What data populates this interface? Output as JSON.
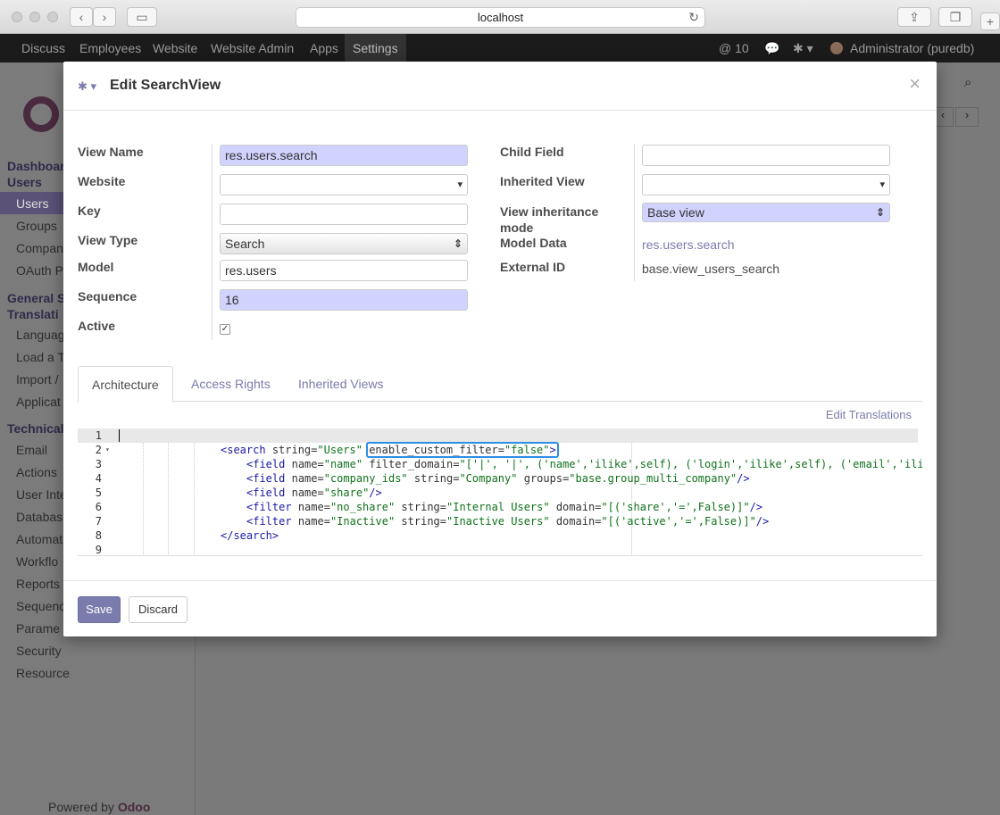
{
  "browser": {
    "url": "localhost"
  },
  "topnav": {
    "menus": [
      "Discuss",
      "Employees",
      "Website",
      "Website Admin",
      "Apps",
      "Settings"
    ],
    "active_menu": "Settings",
    "mentions": "@ 10",
    "user": "Administrator (puredb)"
  },
  "sidebar": {
    "items": [
      {
        "label": "Dashboar",
        "type": "section"
      },
      {
        "label": "Users",
        "type": "section-selected"
      },
      {
        "label": "Users",
        "type": "item"
      },
      {
        "label": "Groups",
        "type": "item"
      },
      {
        "label": "Compan",
        "type": "item"
      },
      {
        "label": "OAuth P",
        "type": "item"
      },
      {
        "label": "General S",
        "type": "section"
      },
      {
        "label": "Translati",
        "type": "section"
      },
      {
        "label": "Languag",
        "type": "item"
      },
      {
        "label": "Load a T",
        "type": "item"
      },
      {
        "label": "Import /",
        "type": "item"
      },
      {
        "label": "Applicat",
        "type": "item"
      },
      {
        "label": "Technical",
        "type": "section"
      },
      {
        "label": "Email",
        "type": "item"
      },
      {
        "label": "Actions",
        "type": "item"
      },
      {
        "label": "User Inte",
        "type": "item"
      },
      {
        "label": "Databas",
        "type": "item"
      },
      {
        "label": "Automat",
        "type": "item"
      },
      {
        "label": "Workflo",
        "type": "item"
      },
      {
        "label": "Reports",
        "type": "item"
      },
      {
        "label": "Sequenc",
        "type": "item"
      },
      {
        "label": "Parame",
        "type": "item"
      },
      {
        "label": "Security",
        "type": "item"
      },
      {
        "label": "Resource",
        "type": "item"
      }
    ],
    "powered_prefix": "Powered by",
    "powered_brand": "Odoo"
  },
  "modal": {
    "title": "Edit SearchView",
    "left_fields": [
      {
        "label": "View Name",
        "value": "res.users.search"
      },
      {
        "label": "Website",
        "value": ""
      },
      {
        "label": "Key",
        "value": ""
      },
      {
        "label": "View Type",
        "value": "Search"
      },
      {
        "label": "Model",
        "value": "res.users"
      },
      {
        "label": "Sequence",
        "value": "16"
      },
      {
        "label": "Active",
        "value": "✓"
      }
    ],
    "right_fields": [
      {
        "label": "Child Field",
        "value": ""
      },
      {
        "label": "Inherited View",
        "value": ""
      },
      {
        "label": "View inheritance",
        "label2": "mode",
        "value": "Base view"
      },
      {
        "label": "Model Data",
        "value": "res.users.search"
      },
      {
        "label": "External ID",
        "value": "base.view_users_search"
      }
    ],
    "tabs": [
      "Architecture",
      "Access Rights",
      "Inherited Views"
    ],
    "active_tab": "Architecture",
    "edit_translations": "Edit Translations",
    "code_lines": [
      {
        "n": "1",
        "html": ""
      },
      {
        "n": "2",
        "html": "<search string=\"Users\" enable_custom_filter=\"false\">"
      },
      {
        "n": "3",
        "html": "<field name=\"name\" filter_domain=\"['|', '|', ('name','ilike',self), ('login','ilike',self), ('email','ili"
      },
      {
        "n": "4",
        "html": "<field name=\"company_ids\" string=\"Company\" groups=\"base.group_multi_company\"/>"
      },
      {
        "n": "5",
        "html": "<field name=\"share\"/>"
      },
      {
        "n": "6",
        "html": "<filter name=\"no_share\" string=\"Internal Users\" domain=\"[('share','=',False)]\"/>"
      },
      {
        "n": "7",
        "html": "<filter name=\"Inactive\" string=\"Inactive Users\" domain=\"[('active','=',False)]\"/>"
      },
      {
        "n": "8",
        "html": "</search>"
      },
      {
        "n": "9",
        "html": ""
      }
    ],
    "save_label": "Save",
    "discard_label": "Discard"
  }
}
